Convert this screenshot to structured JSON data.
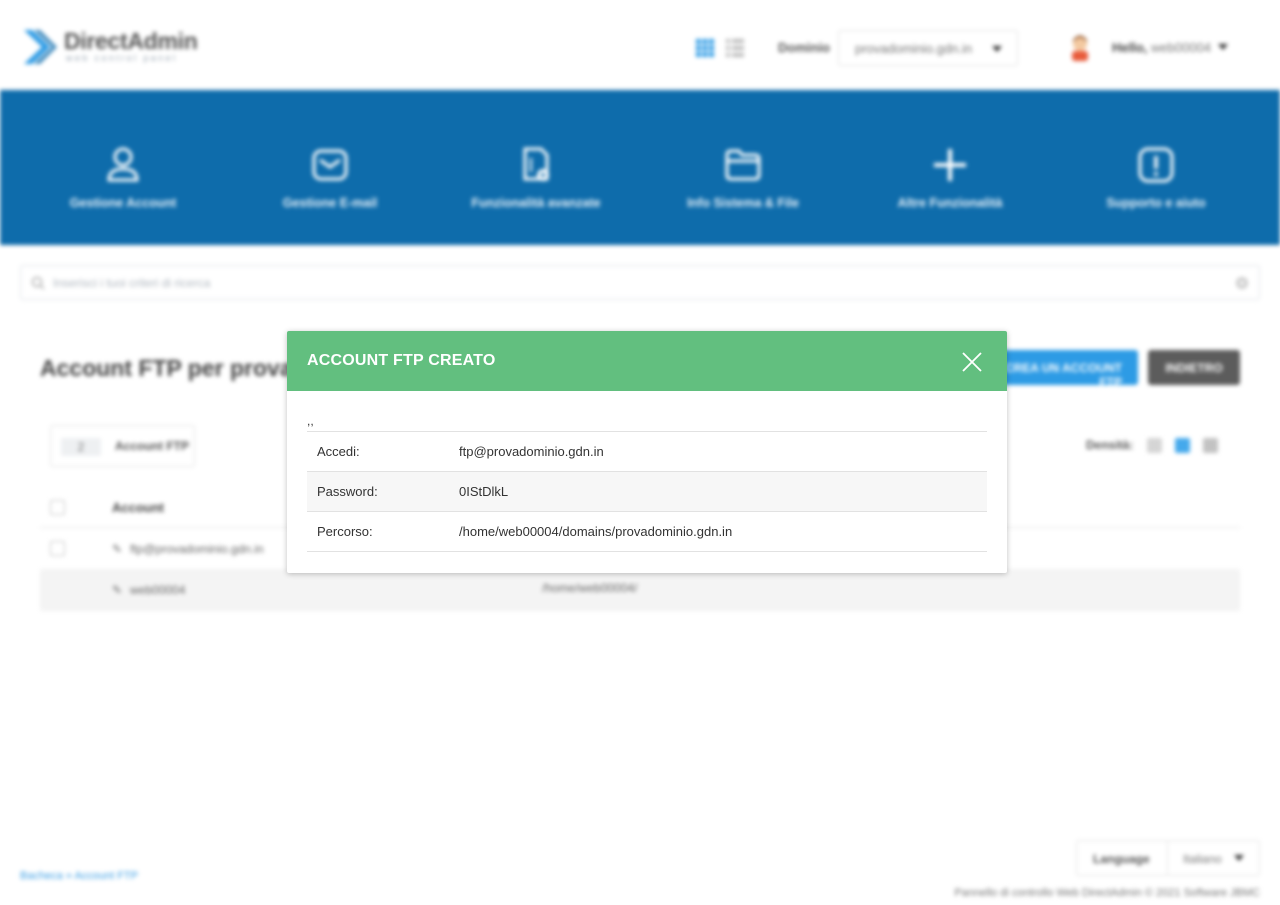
{
  "header": {
    "logo_text": "DirectAdmin",
    "logo_sub": "web control panel",
    "domain_label": "Dominio",
    "domain_value": "provadominio.gdn.in",
    "hello_prefix": "Hello,",
    "username": "web00004"
  },
  "nav": [
    {
      "label": "Gestione Account",
      "icon": "user-icon"
    },
    {
      "label": "Gestione E-mail",
      "icon": "mail-icon"
    },
    {
      "label": "Funzionalità avanzate",
      "icon": "advanced-file-icon"
    },
    {
      "label": "Info Sistema & File",
      "icon": "folder-icon"
    },
    {
      "label": "Altre Funzionalità",
      "icon": "plus-icon"
    },
    {
      "label": "Supporto e aiuto",
      "icon": "help-icon"
    }
  ],
  "search": {
    "placeholder": "Inserisci i tuoi criteri di ricerca"
  },
  "page": {
    "title": "Account FTP per provadominio.gdn.in",
    "create_button": "CREA UN ACCOUNT FTP",
    "back_button": "INDIETRO",
    "count": "2",
    "count_label": "Account FTP",
    "density_label": "Densità:"
  },
  "table": {
    "header_account": "Account",
    "rows": [
      {
        "account": "ftp@provadominio.gdn.in",
        "path": ""
      },
      {
        "account": "web00004",
        "path": "/home/web00004/"
      }
    ]
  },
  "footer": {
    "breadcrumb_home": "Bacheca",
    "breadcrumb_sep": "»",
    "breadcrumb_current": "Account FTP",
    "language_label": "Language",
    "language_value": "Italiano",
    "copyright": "Pannello di controllo Web DirectAdmin © 2021 Software JBMC"
  },
  "modal": {
    "title": "ACCOUNT FTP CREATO",
    "note": ",,",
    "rows": [
      {
        "key": "Accedi:",
        "value": "ftp@provadominio.gdn.in"
      },
      {
        "key": "Password:",
        "value": "0IStDlkL"
      },
      {
        "key": "Percorso:",
        "value": "/home/web00004/domains/provadominio.gdn.in"
      }
    ]
  },
  "colors": {
    "brand_blue": "#0e6cab",
    "accent_blue": "#2d9be5",
    "modal_green": "#62bf7f"
  }
}
